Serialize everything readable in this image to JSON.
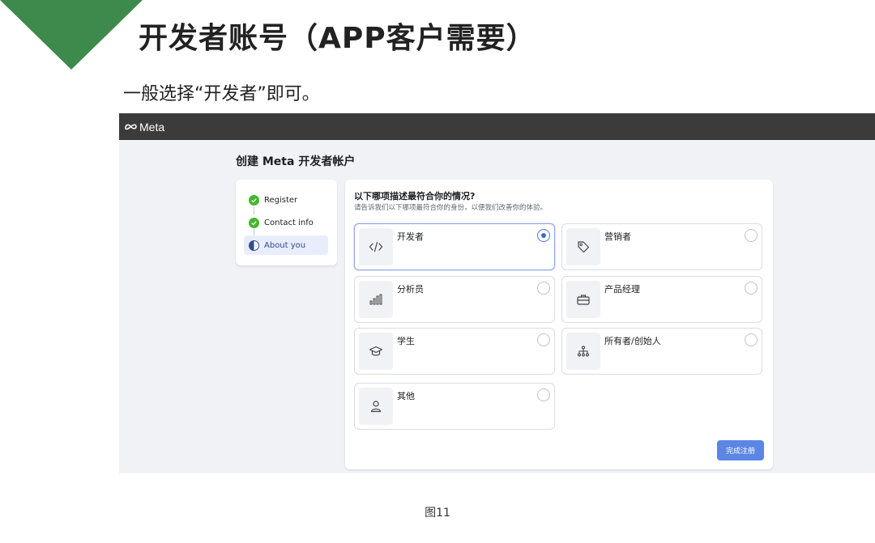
{
  "slide": {
    "title": "开发者账号（APP客户需要）",
    "subtitle": "一般选择“开发者”即可。",
    "caption": "图11",
    "accent_color": "#3e8a4c"
  },
  "meta_header": {
    "logo_text": "Meta",
    "bar_color": "#3b3b3b"
  },
  "page": {
    "title": "创建 Meta 开发者帐户"
  },
  "steps": [
    {
      "label": "Register",
      "status": "complete",
      "icon": "check-circle-icon"
    },
    {
      "label": "Contact info",
      "status": "complete",
      "icon": "check-circle-icon"
    },
    {
      "label": "About you",
      "status": "current",
      "icon": "half-circle-icon"
    }
  ],
  "form": {
    "question": "以下哪项描述最符合你的情况?",
    "hint": "请告诉我们以下哪项最符合你的身份，以便我们改善你的体验。",
    "options": [
      {
        "label": "开发者",
        "icon": "code-icon",
        "selected": true
      },
      {
        "label": "营销者",
        "icon": "tag-icon",
        "selected": false
      },
      {
        "label": "分析员",
        "icon": "bar-chart-icon",
        "selected": false
      },
      {
        "label": "产品经理",
        "icon": "briefcase-icon",
        "selected": false
      },
      {
        "label": "学生",
        "icon": "graduation-cap-icon",
        "selected": false
      },
      {
        "label": "所有者/创始人",
        "icon": "org-chart-icon",
        "selected": false
      },
      {
        "label": "其他",
        "icon": "person-icon",
        "selected": false
      }
    ],
    "submit_label": "完成注册",
    "accent_color": "#5b86e5"
  }
}
